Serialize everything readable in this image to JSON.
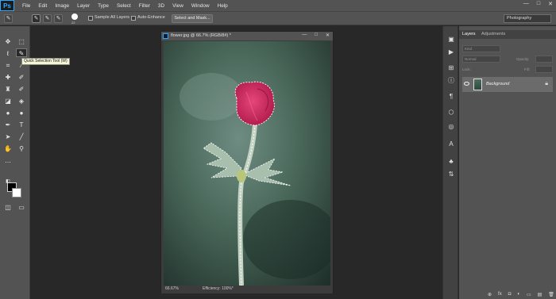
{
  "menubar": {
    "logo": "Ps",
    "items": [
      "File",
      "Edit",
      "Image",
      "Layer",
      "Type",
      "Select",
      "Filter",
      "3D",
      "View",
      "Window",
      "Help"
    ],
    "window_controls": [
      "—",
      "□",
      "✕"
    ]
  },
  "options_bar": {
    "brush_size": "22",
    "sample_all_layers": "Sample All Layers",
    "auto_enhance": "Auto-Enhance",
    "select_and_mask": "Select and Mask...",
    "workspace": "Photography"
  },
  "toolbar": {
    "tooltip": "Quick Selection Tool (W)",
    "foreground_color": "#000000",
    "background_color": "#ffffff"
  },
  "document": {
    "title": "flower.jpg @ 66.7% (RGB/8#) *",
    "controls": [
      "—",
      "□",
      "✕"
    ],
    "zoom": "66.67%",
    "status": "Efficiency: 100%*"
  },
  "layers_panel": {
    "tabs": [
      "Layers",
      "Adjustments"
    ],
    "filter_placeholder": "Kind",
    "blend_mode": "Normal",
    "opacity_label": "Opacity:",
    "lock_label": "Lock:",
    "fill_label": "Fill:",
    "layer_name": "Background",
    "footer_icons": [
      "⊕",
      "fx",
      "◘",
      "◐",
      "▭",
      "▤",
      "🗑"
    ]
  }
}
